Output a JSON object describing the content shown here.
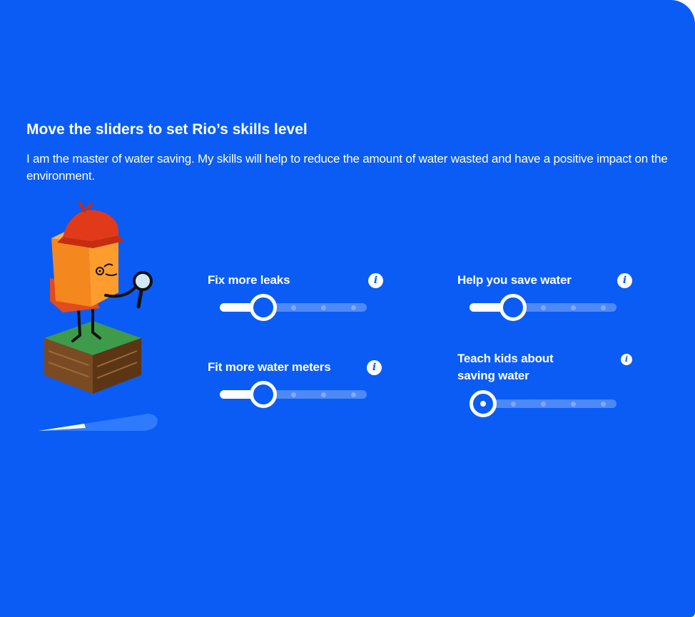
{
  "header": {
    "title": "Move the sliders to set Rio’s skills level",
    "description": "I am the master of water saving. My skills will help to reduce the amount of water wasted and have a positive impact on the environment."
  },
  "info_glyph": "i",
  "colors": {
    "background": "#0a5cf5",
    "text": "#ffffff",
    "track": "rgba(255,255,255,0.28)"
  },
  "skills": [
    {
      "label": "Fix more leaks",
      "value": 1,
      "max": 4,
      "icon": "info-icon"
    },
    {
      "label": "Help you save water",
      "value": 1,
      "max": 4,
      "icon": "info-icon"
    },
    {
      "label": "Fit more water meters",
      "value": 1,
      "max": 4,
      "icon": "info-icon"
    },
    {
      "label": "Teach kids about saving water",
      "value": 0,
      "max": 4,
      "icon": "info-icon"
    }
  ]
}
